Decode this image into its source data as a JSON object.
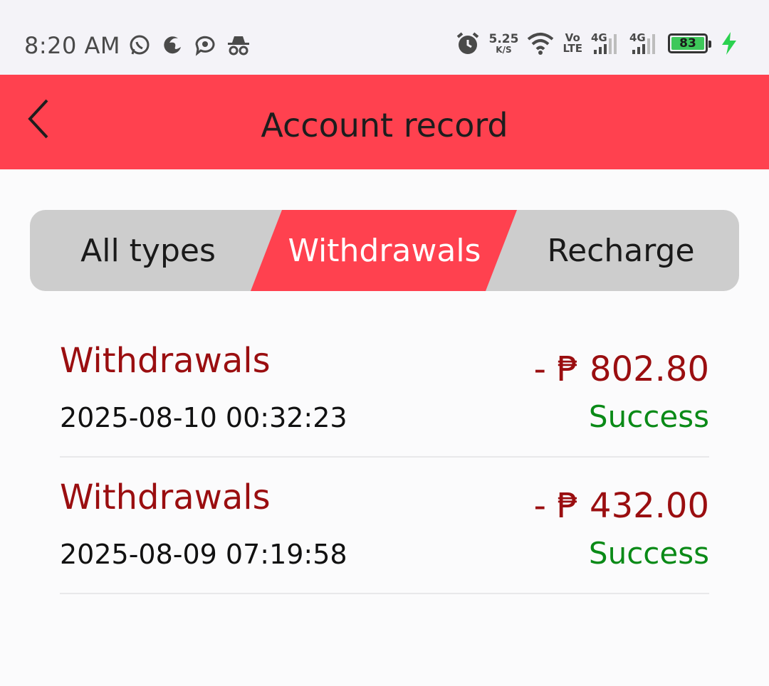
{
  "status_bar": {
    "time": "8:20 AM",
    "left_icons": [
      "whatsapp-icon",
      "edge-icon",
      "chat-bubble-icon",
      "incognito-icon"
    ],
    "network_speed_value": "5.25",
    "network_speed_unit": "K/S",
    "volte_top": "Vo",
    "volte_bottom": "LTE",
    "sim1_label": "4G",
    "sim2_label": "4G",
    "battery_percent": "83",
    "colors": {
      "battery_fill": "#3ec85a",
      "charging": "#2bd14f"
    }
  },
  "header": {
    "title": "Account record",
    "background": "#ff414f"
  },
  "tabs": [
    {
      "label": "All types",
      "active": false
    },
    {
      "label": "Withdrawals",
      "active": true
    },
    {
      "label": "Recharge",
      "active": false
    }
  ],
  "records": [
    {
      "type": "Withdrawals",
      "datetime": "2025-08-10 00:32:23",
      "amount": "- ₱ 802.80",
      "status": "Success"
    },
    {
      "type": "Withdrawals",
      "datetime": "2025-08-09 07:19:58",
      "amount": "- ₱ 432.00",
      "status": "Success"
    }
  ],
  "colors": {
    "accent": "#ff414f",
    "amount_text": "#9a0e10",
    "success_text": "#0a8a17",
    "tab_bg": "#cdcdcd"
  }
}
